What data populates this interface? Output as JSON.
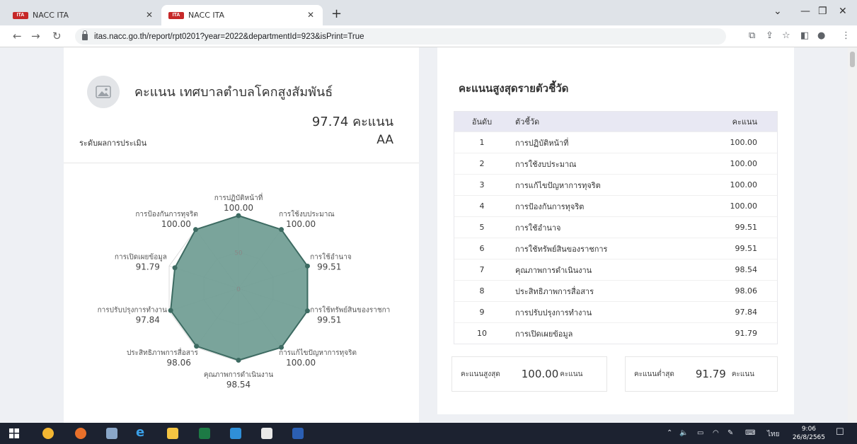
{
  "browser": {
    "tabs": [
      {
        "label": "NACC ITA",
        "favicon": "ITA"
      },
      {
        "label": "NACC ITA",
        "favicon": "ITA"
      }
    ],
    "url": "itas.nacc.go.th/report/rpt0201?year=2022&departmentId=923&isPrint=True"
  },
  "summary": {
    "title": "คะแนน เทศบาลตำบลโคกสูงสัมพันธ์",
    "score": "97.74 คะแนน",
    "level_label": "ระดับผลการประเมิน",
    "level_value": "AA"
  },
  "chart_data": {
    "type": "radar",
    "rlim": [
      0,
      100
    ],
    "grid_labels": [
      "0",
      "50"
    ],
    "categories": [
      "การปฏิบัติหน้าที่",
      "การใช้งบประมาณ",
      "การใช้อำนาจ",
      "การใช้ทรัพย์สินของราชการ",
      "การแก้ไขปัญหาการทุจริต",
      "คุณภาพการดำเนินงาน",
      "ประสิทธิภาพการสื่อสาร",
      "การปรับปรุงการทำงาน",
      "การเปิดเผยข้อมูล",
      "การป้องกันการทุจริต"
    ],
    "category_labels": [
      "การปฏิบัติหน้าที่",
      "การใช้งบประมาณ",
      "การใช้อำนาจ",
      "การใช้ทรัพย์สินของราชกา",
      "การแก้ไขปัญหาการทุจริต",
      "คุณภาพการดำเนินงาน",
      "ประสิทธิภาพการสื่อสาร",
      "การปรับปรุงการทำงาน",
      "การเปิดเผยข้อมูล",
      "การป้องกันการทุจริต"
    ],
    "value_labels": [
      "100.00",
      "100.00",
      "99.51",
      "99.51",
      "100.00",
      "98.54",
      "98.06",
      "97.84",
      "91.79",
      "100.00"
    ],
    "values": [
      100.0,
      100.0,
      99.51,
      99.51,
      100.0,
      98.54,
      98.06,
      97.84,
      91.79,
      100.0
    ],
    "fill_color": "#6f9c93",
    "line_color": "#3d6b62"
  },
  "ranking": {
    "title": "คะแนนสูงสุดรายตัวชี้วัด",
    "headers": {
      "rank": "อันดับ",
      "indicator": "ตัวชี้วัด",
      "score": "คะแนน"
    },
    "rows": [
      {
        "rank": "1",
        "name": "การปฏิบัติหน้าที่",
        "score": "100.00"
      },
      {
        "rank": "2",
        "name": "การใช้งบประมาณ",
        "score": "100.00"
      },
      {
        "rank": "3",
        "name": "การแก้ไขปัญหาการทุจริต",
        "score": "100.00"
      },
      {
        "rank": "4",
        "name": "การป้องกันการทุจริต",
        "score": "100.00"
      },
      {
        "rank": "5",
        "name": "การใช้อำนาจ",
        "score": "99.51"
      },
      {
        "rank": "6",
        "name": "การใช้ทรัพย์สินของราชการ",
        "score": "99.51"
      },
      {
        "rank": "7",
        "name": "คุณภาพการดำเนินงาน",
        "score": "98.54"
      },
      {
        "rank": "8",
        "name": "ประสิทธิภาพการสื่อสาร",
        "score": "98.06"
      },
      {
        "rank": "9",
        "name": "การปรับปรุงการทำงาน",
        "score": "97.84"
      },
      {
        "rank": "10",
        "name": "การเปิดเผยข้อมูล",
        "score": "91.79"
      }
    ],
    "max_label": "คะแนนสูงสุด",
    "max_value": "100.00",
    "min_label": "คะแนนต่ำสุด",
    "min_value": "91.79",
    "unit": "คะแนน"
  },
  "taskbar": {
    "lang": "ไทย",
    "time": "9:06",
    "date": "26/8/2565"
  }
}
